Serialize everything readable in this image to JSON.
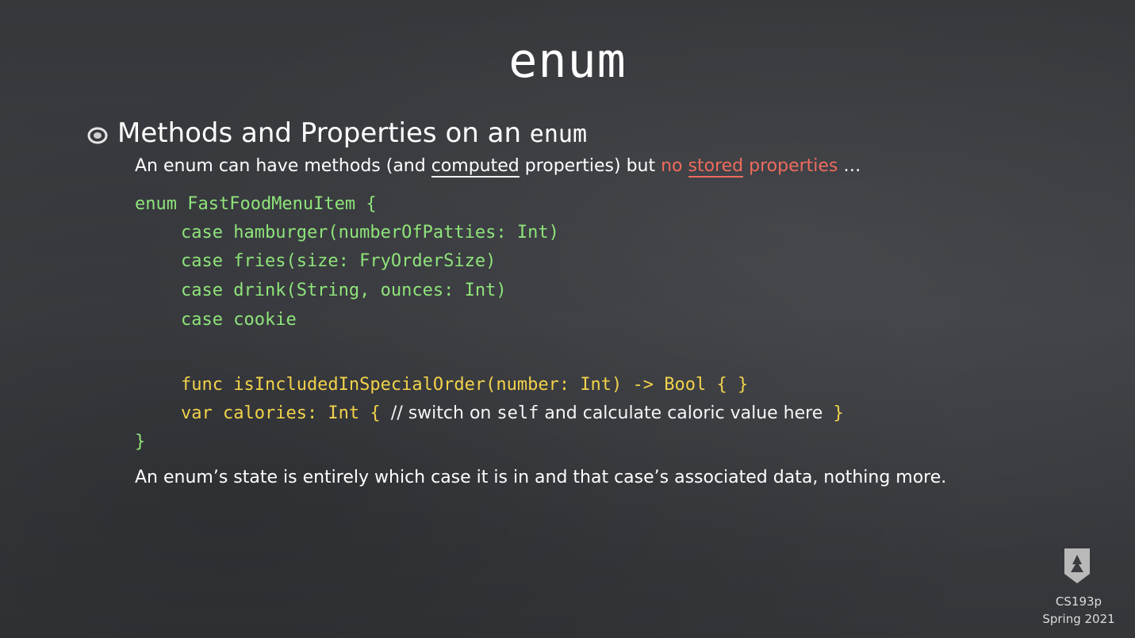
{
  "slide": {
    "title": "enum",
    "heading_text": "Methods and Properties on an ",
    "heading_code": "enum",
    "intro": {
      "part1": "An enum can have methods (and ",
      "computed": "computed",
      "part2": " properties) but ",
      "no": "no ",
      "stored": "stored",
      "properties": " properties",
      "ellipsis": " …"
    },
    "code": {
      "line1": "enum FastFoodMenuItem {",
      "line2": "case hamburger(numberOfPatties: Int)",
      "line3": "case fries(size: FryOrderSize)",
      "line4": "case drink(String, ounces: Int)",
      "line5": "case cookie",
      "line6": "func isIncludedInSpecialOrder(number: Int) -> Bool { }",
      "line7_prefix": "var calories: Int { ",
      "line7_comment_slash": "// switch on ",
      "line7_self": "self",
      "line7_comment_rest": " and calculate caloric value here",
      "line7_suffix": " }",
      "line8": "}"
    },
    "outro": "An enum’s state is entirely which case it is in and that case’s associated data, nothing more.",
    "course_code": "CS193p",
    "term": "Spring 2021"
  },
  "colors": {
    "code_green": "#8fe47a",
    "code_yellow": "#f2d24a",
    "highlight_red": "#ef6b5e",
    "background": "#3a3c40"
  }
}
